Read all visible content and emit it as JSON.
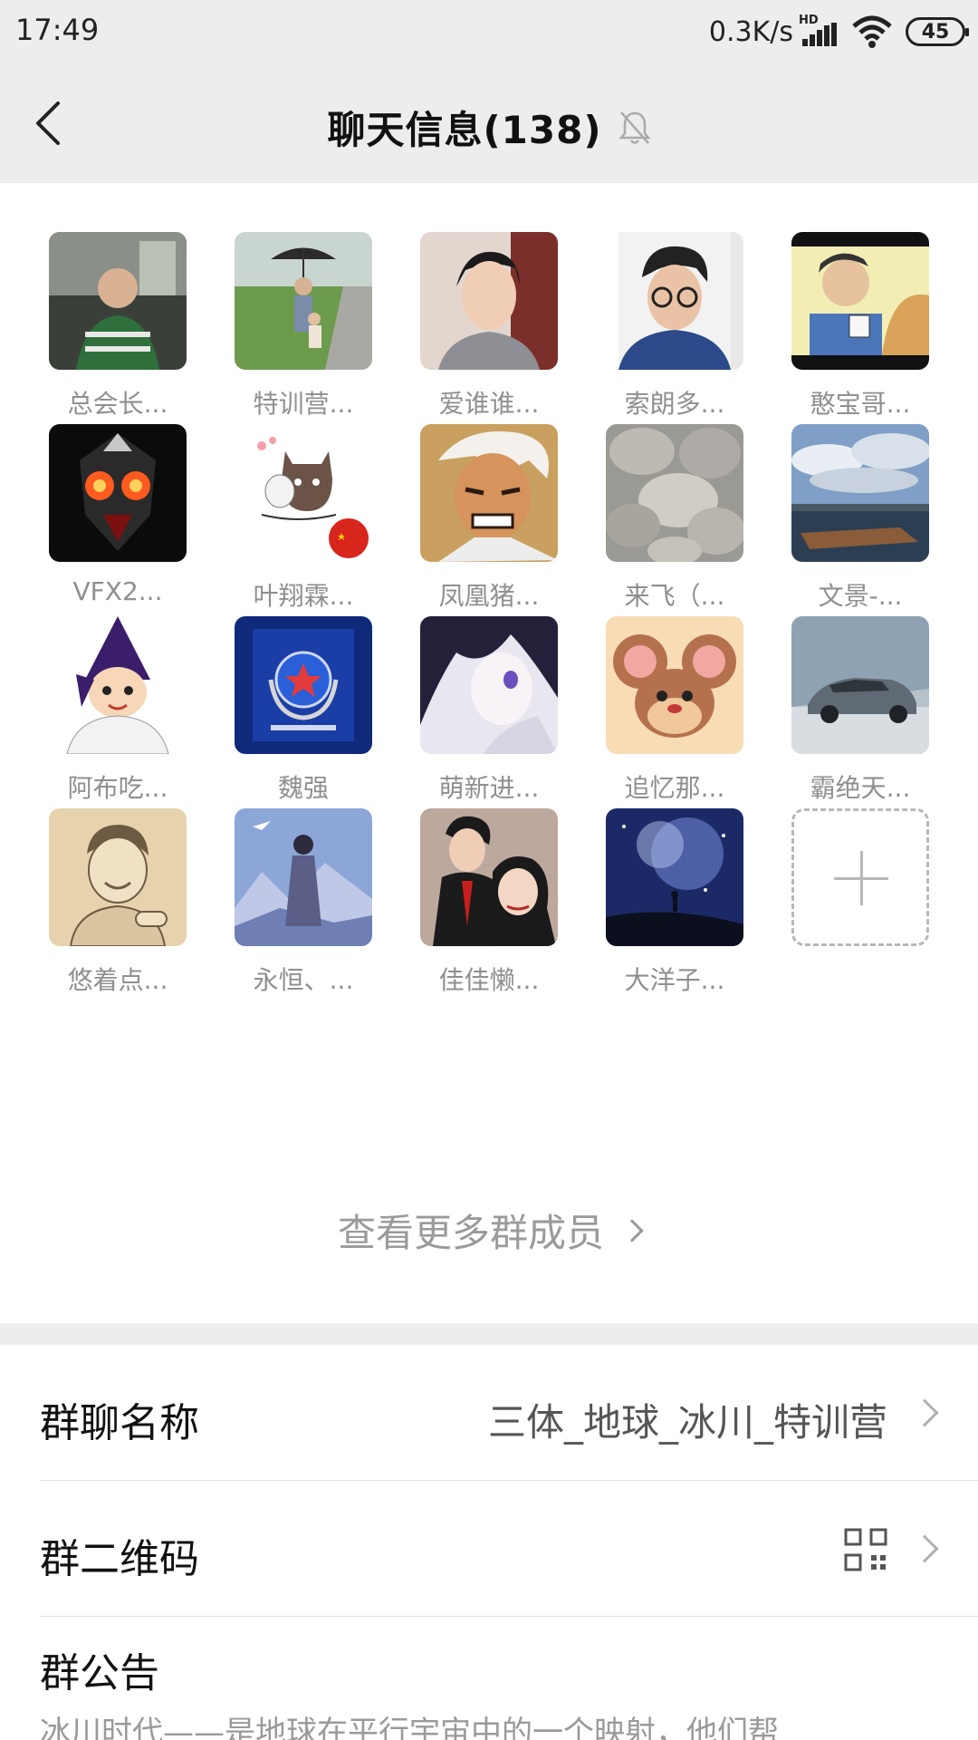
{
  "status_bar": {
    "time": "17:49",
    "network_speed": "0.3K/s",
    "network_type": "HD",
    "battery": "45"
  },
  "header": {
    "title": "聊天信息(138)"
  },
  "members": [
    {
      "name": "总会长...",
      "avatar": "photo-man-green-shirt"
    },
    {
      "name": "特训营...",
      "avatar": "photo-umbrella-field"
    },
    {
      "name": "爱谁谁...",
      "avatar": "photo-young-man-selfie"
    },
    {
      "name": "索朗多...",
      "avatar": "photo-man-glasses"
    },
    {
      "name": "憨宝哥...",
      "avatar": "cartoon-man"
    },
    {
      "name": "VFX2...",
      "avatar": "dark-robot-helmet"
    },
    {
      "name": "叶翔霖...",
      "avatar": "cartoon-cats-flag"
    },
    {
      "name": "凤凰猪...",
      "avatar": "anime-old-man"
    },
    {
      "name": "来飞（...",
      "avatar": "photo-stones"
    },
    {
      "name": "文景-...",
      "avatar": "photo-lake-pier"
    },
    {
      "name": "阿布吃...",
      "avatar": "cartoon-hooded-kid"
    },
    {
      "name": "魏强",
      "avatar": "police-emblem-blue"
    },
    {
      "name": "萌新进...",
      "avatar": "anime-girl"
    },
    {
      "name": "追忆那...",
      "avatar": "cartoon-mouse"
    },
    {
      "name": "霸绝天...",
      "avatar": "photo-car"
    },
    {
      "name": "悠着点...",
      "avatar": "sketch-man-pointing"
    },
    {
      "name": "永恒、...",
      "avatar": "illustration-girl-mountains"
    },
    {
      "name": "佳佳懒...",
      "avatar": "photo-couple"
    },
    {
      "name": "大洋子...",
      "avatar": "photo-night-sky"
    }
  ],
  "add_member": {
    "icon": "plus-icon"
  },
  "view_more": "查看更多群成员",
  "settings": {
    "group_name_label": "群聊名称",
    "group_name_value": "三体_地球_冰川_特训营",
    "qr_label": "群二维码",
    "notice_label": "群公告",
    "notice_text": "冰川时代——是地球在平行宇宙中的一个映射，他们帮"
  }
}
